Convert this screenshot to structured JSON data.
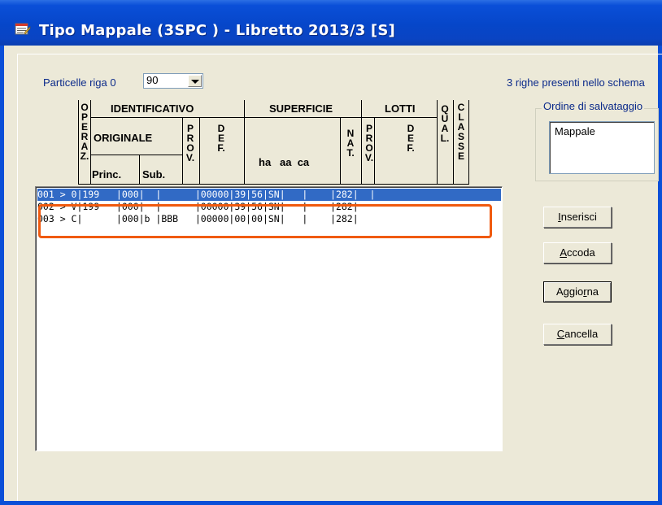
{
  "window": {
    "title": "Tipo Mappale (3SPC ) - Libretto 2013/3 [S]",
    "icon": "form-icon"
  },
  "particelle": {
    "label": "Particelle riga 0",
    "value": "90"
  },
  "status_text": "3 righe presenti nello schema",
  "table_headers": {
    "operaz": "OPERAZ.",
    "identificativo": "IDENTIFICATIVO",
    "originale": "ORIGINALE",
    "princ": "Princ.",
    "sub": "Sub.",
    "prov": "PROV.",
    "def": "DEF.",
    "superficie": "SUPERFICIE",
    "ha_aa_ca": "ha   aa  ca",
    "nat": "NAT.",
    "lotti": "LOTTI",
    "lotti_prov": "PROV.",
    "lotti_def": "DEF.",
    "qual": "QUAL.",
    "classe": "CLASSE"
  },
  "rows": [
    {
      "text": "001 > 0|199   |000|  |      |00000|39|56|SN|   |    |282|  |",
      "selected": true
    },
    {
      "text": "002 > V|199   |000|  |      |00000|39|56|SN|   |    |282|",
      "selected": false
    },
    {
      "text": "003 > C|      |000|b |BBB   |00000|00|00|SN|   |    |282|",
      "selected": false
    }
  ],
  "ordine": {
    "title": "Ordine di salvataggio",
    "value": "Mappale"
  },
  "buttons": {
    "inserisci": {
      "prefix": "",
      "accel": "I",
      "rest": "nserisci"
    },
    "accoda": {
      "prefix": "",
      "accel": "A",
      "rest": "ccoda"
    },
    "aggiorna": {
      "prefix": "Aggio",
      "accel": "r",
      "rest": "na"
    },
    "cancella": {
      "prefix": "",
      "accel": "C",
      "rest": "ancella"
    }
  },
  "colors": {
    "titlebar": "#0a4fd8",
    "selection": "#316ac5",
    "highlight": "#f05a0f",
    "label": "#0b2a8a"
  }
}
